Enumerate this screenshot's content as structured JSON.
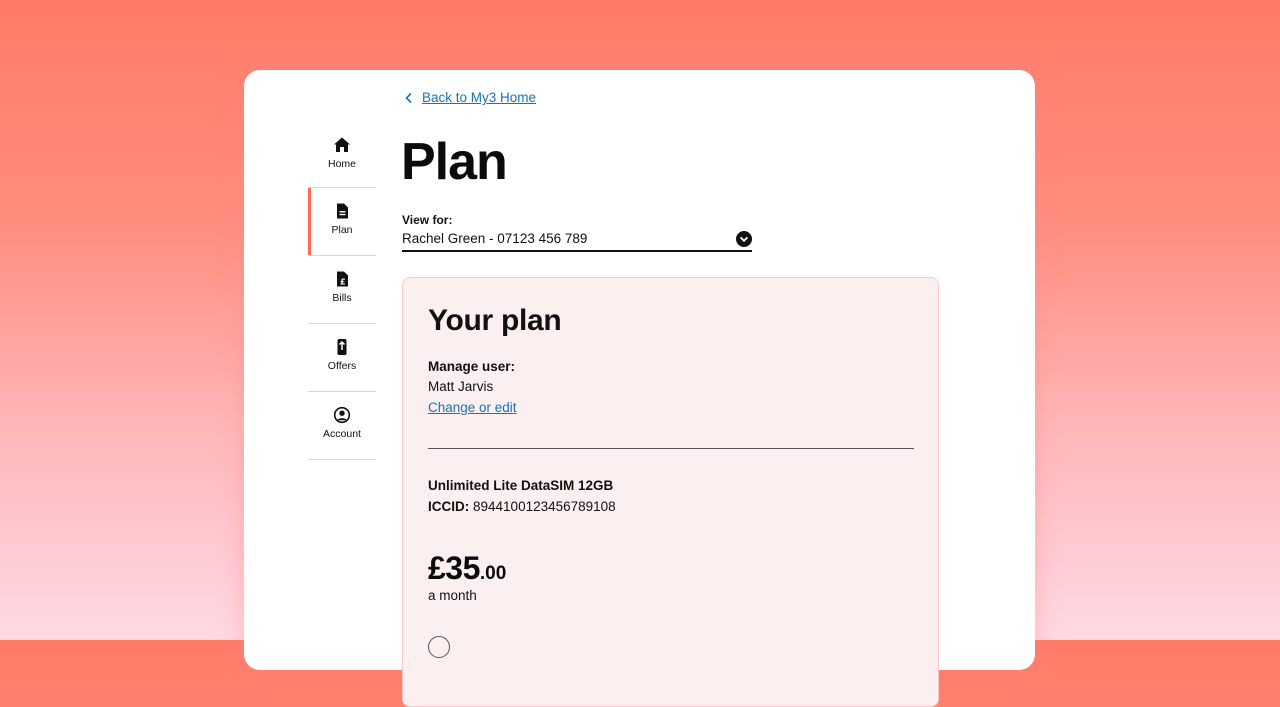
{
  "back_link": {
    "label": "Back to My3 Home"
  },
  "page": {
    "title": "Plan"
  },
  "sidebar": {
    "items": [
      {
        "label": "Home",
        "icon": "home-icon",
        "active": false
      },
      {
        "label": "Plan",
        "icon": "sim-document-icon",
        "active": true
      },
      {
        "label": "Bills",
        "icon": "bill-icon",
        "active": false
      },
      {
        "label": "Offers",
        "icon": "offers-phone-icon",
        "active": false
      },
      {
        "label": "Account",
        "icon": "account-icon",
        "active": false
      }
    ]
  },
  "view_for": {
    "label": "View for:",
    "selected": "Rachel Green - 07123 456 789"
  },
  "plan_card": {
    "title": "Your plan",
    "manage_user_label": "Manage user:",
    "manage_user_name": "Matt Jarvis",
    "change_link": "Change or edit",
    "plan_name": "Unlimited Lite DataSIM 12GB",
    "iccid_label": "ICCID:",
    "iccid_value": "8944100123456789108",
    "price_major": "£35",
    "price_minor": ".00",
    "price_period": "a month"
  },
  "colors": {
    "accent": "#ff6a57",
    "link": "#1a73b8",
    "card_tint": "#fbeff0"
  }
}
